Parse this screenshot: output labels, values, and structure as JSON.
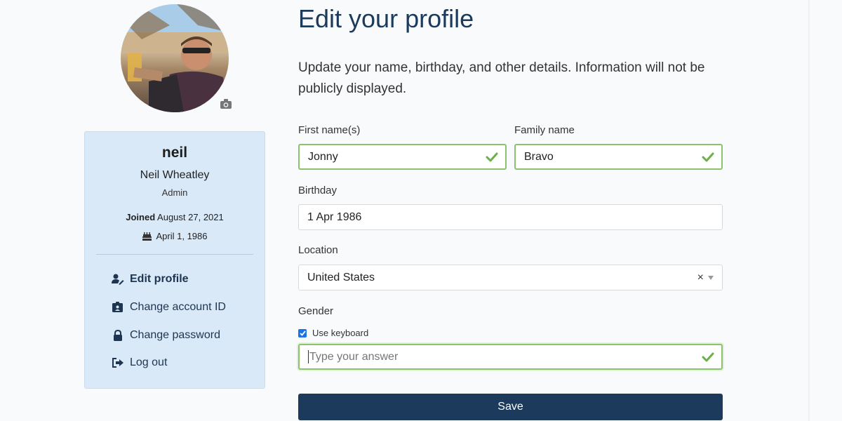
{
  "sidebar": {
    "username": "neil",
    "full_name": "Neil Wheatley",
    "role": "Admin",
    "joined_label": "Joined",
    "joined_date": "August 27, 2021",
    "birthday": "April 1, 1986",
    "menu": [
      {
        "label": "Edit profile",
        "icon": "user-edit-icon",
        "active": true
      },
      {
        "label": "Change account ID",
        "icon": "id-card-icon",
        "active": false
      },
      {
        "label": "Change password",
        "icon": "lock-icon",
        "active": false
      },
      {
        "label": "Log out",
        "icon": "sign-out-icon",
        "active": false
      }
    ]
  },
  "form": {
    "title": "Edit your profile",
    "intro": "Update your name, birthday, and other details. Information will not be publicly displayed.",
    "first_name": {
      "label": "First name(s)",
      "value": "Jonny"
    },
    "family_name": {
      "label": "Family name",
      "value": "Bravo"
    },
    "birthday": {
      "label": "Birthday",
      "value": "1 Apr 1986"
    },
    "location": {
      "label": "Location",
      "value": "United States",
      "clear": "×"
    },
    "gender": {
      "label": "Gender",
      "checkbox_label": "Use keyboard",
      "placeholder": "Type your answer"
    },
    "save_label": "Save"
  },
  "colors": {
    "primary": "#1b3a5c",
    "card_bg": "#d9e9f8",
    "valid": "#6bb04a",
    "checkbox": "#1a73e8"
  }
}
